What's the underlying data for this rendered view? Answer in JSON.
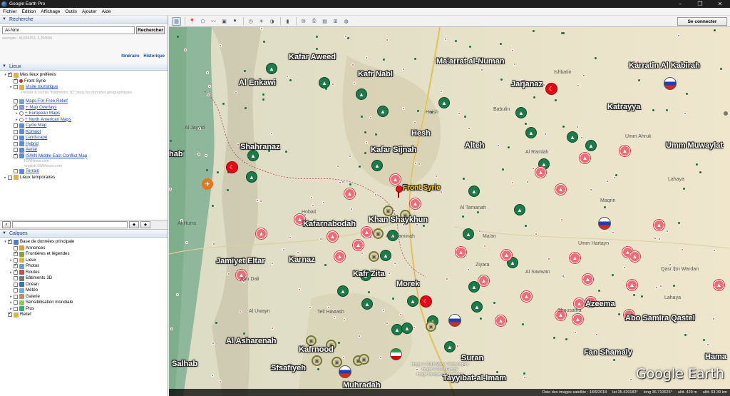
{
  "window": {
    "title": "Google Earth Pro"
  },
  "menu": [
    "Fichier",
    "Édition",
    "Affichage",
    "Outils",
    "Ajouter",
    "Aide"
  ],
  "search": {
    "header": "Recherche",
    "value": "Al-Nmr",
    "button": "Rechercher",
    "example": "exemple : 46,836253, 3,254696",
    "links": {
      "itinerary": "Itinéraire",
      "history": "Historique"
    }
  },
  "places": {
    "header": "Lieux",
    "items": [
      {
        "label": "Mes lieux préférés",
        "level": 0,
        "check": "on",
        "icon": "folder",
        "link": false
      },
      {
        "label": "Front Syrie",
        "level": 1,
        "check": "on",
        "icon": "pushpin",
        "link": false
      },
      {
        "label": "Visite touristique",
        "level": 1,
        "check": "off",
        "icon": "folder",
        "link": true
      },
      {
        "label": "Maps-For-Free Relief",
        "level": 1,
        "check": "off",
        "icon": "overlay",
        "link": true
      },
      {
        "label": "+ Map Overlays",
        "level": 1,
        "check": "on",
        "icon": "overlay",
        "link": true
      },
      {
        "label": "+ European Maps",
        "level": 2,
        "check": "radio",
        "icon": "",
        "link": true
      },
      {
        "label": "+ North American Maps",
        "level": 2,
        "check": "radio",
        "icon": "",
        "link": true
      },
      {
        "label": "Cycle Map",
        "level": 1,
        "check": "off",
        "icon": "map",
        "link": true
      },
      {
        "label": "Komoot",
        "level": 1,
        "check": "off",
        "icon": "map",
        "link": true
      },
      {
        "label": "Landscape",
        "level": 1,
        "check": "off",
        "icon": "map",
        "link": true
      },
      {
        "label": "Hybrid",
        "level": 1,
        "check": "off",
        "icon": "map",
        "link": true
      },
      {
        "label": "Aerial",
        "level": 1,
        "check": "off",
        "icon": "map",
        "link": true
      },
      {
        "label": "ISWN Middle East Conflict Map",
        "level": 1,
        "check": "on",
        "icon": "map",
        "link": true
      },
      {
        "label": "Terrain",
        "level": 1,
        "check": "off",
        "icon": "map",
        "link": true
      },
      {
        "label": "Lieux temporaires",
        "level": 0,
        "check": "off",
        "icon": "folder",
        "link": false
      }
    ],
    "tourist_note": "Penser à cocher \"Bâtiments 3D\" dans les données géographiques",
    "iswn_sub1": "ISWNews.com",
    "iswn_sub2": "english.ISWNews.com"
  },
  "layers": {
    "header": "Calques",
    "items": [
      {
        "label": "Base de données principale",
        "level": 0,
        "check": "on"
      },
      {
        "label": "Annonces",
        "level": 1,
        "check": "off"
      },
      {
        "label": "Frontières et légendes",
        "level": 1,
        "check": "on"
      },
      {
        "label": "Lieux",
        "level": 1,
        "check": "off"
      },
      {
        "label": "Photos",
        "level": 1,
        "check": "on"
      },
      {
        "label": "Routes",
        "level": 1,
        "check": "on"
      },
      {
        "label": "Bâtiments 3D",
        "level": 1,
        "check": "off"
      },
      {
        "label": "Océan",
        "level": 1,
        "check": "off"
      },
      {
        "label": "Météo",
        "level": 1,
        "check": "off"
      },
      {
        "label": "Galerie",
        "level": 1,
        "check": "off"
      },
      {
        "label": "Sensibilisation mondiale",
        "level": 1,
        "check": "off"
      },
      {
        "label": "Plus",
        "level": 1,
        "check": "off"
      },
      {
        "label": "Relief",
        "level": 0,
        "check": "on"
      }
    ]
  },
  "toolbar": {
    "connect": "Se connecter"
  },
  "map": {
    "places": [
      "Kafar Aweed",
      "Kafr Nabl",
      "Ma'arrat al-Numan",
      "Jarjanaz",
      "Karratin Al Kabirah",
      "Al Enkawi",
      "Katrayya",
      "Hesh",
      "Kafar Sijnah",
      "Alteh",
      "Umm Muwaylat",
      "Shahranaz",
      "Front Syrie",
      "Khan Shaykhun",
      "Kafarnabodah",
      "Karnaz",
      "Jamiyet Eltar",
      "Kafr Zita",
      "Morek",
      "Azeema",
      "Abo Samira Qastel",
      "Al Asharenah",
      "Kafrnood",
      "Fan Shamaly",
      "Salhab",
      "Sfsafiyeh",
      "Suran",
      "Muhradah",
      "Tayyibat-al-Imam",
      "Hama",
      "hab"
    ],
    "small_places": [
      "Al Tamanah",
      "Al-Hurra",
      "Al Jayyid",
      "Hobait",
      "Umm Hartayn",
      "Al Ramlah",
      "Al Lataminah",
      "Ma'an",
      "Maqrin",
      "Lahaya",
      "Lahaya",
      "Shousatha",
      "Al Uwayn",
      "Tell Hawash",
      "Ziyara",
      "Qasr Ibn Wardan",
      "Ishbatin",
      "Babulin",
      "Heish",
      "Al Sawwan",
      "Abu Dali",
      "Umm Ahruk"
    ],
    "imagery": [
      "Image © 2018 Maxar Technologies",
      "Image © 2018 Google",
      "Image Landsat / Copernicus"
    ],
    "watermark": "Google Earth",
    "status": {
      "date": "Date des images satellite : 18/6/2018",
      "lat": "lat 35.429183°",
      "lon": "long 36.710625°",
      "alt": "altit. 429 m",
      "eye": "altit. 63.39 km"
    }
  },
  "colors": {
    "green_marker": "#1e7a49",
    "red_marker": "#ef6b78",
    "olive_marker": "#d7d0a2",
    "favorite_label": "#ffd400",
    "header_blue": "#1c3d6e",
    "link_blue": "#1a46b8"
  }
}
